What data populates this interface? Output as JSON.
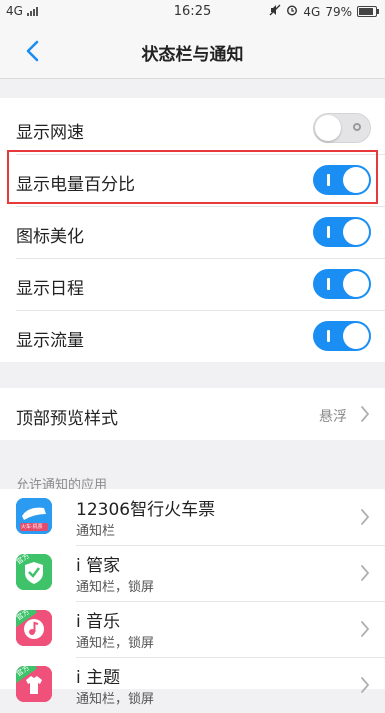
{
  "status_bar": {
    "network": "4G",
    "time": "16:25",
    "network_right": "4G",
    "battery": "79%",
    "icons": [
      "signal-icon",
      "mute-icon",
      "alarm-icon",
      "battery-icon"
    ]
  },
  "nav": {
    "title": "状态栏与通知",
    "back_icon": "back-chevron-icon"
  },
  "toggles": [
    {
      "label": "显示网速",
      "on": false
    },
    {
      "label": "显示电量百分比",
      "on": true
    },
    {
      "label": "图标美化",
      "on": true
    },
    {
      "label": "显示日程",
      "on": true
    },
    {
      "label": "显示流量",
      "on": true
    }
  ],
  "preview": {
    "label": "顶部预览样式",
    "value": "悬浮"
  },
  "apps_section": {
    "header": "允许通知的应用",
    "apps": [
      {
        "name": "12306智行火车票",
        "sub": "通知栏",
        "icon": "train-ticket-icon",
        "icon_text": "火车·机票"
      },
      {
        "name": "i 管家",
        "sub": "通知栏，锁屏",
        "icon": "shield-icon",
        "badge": "官方"
      },
      {
        "name": "i 音乐",
        "sub": "通知栏，锁屏",
        "icon": "music-icon",
        "badge": "官方"
      },
      {
        "name": "i 主题",
        "sub": "通知栏，锁屏",
        "icon": "theme-icon",
        "badge": "官方"
      }
    ]
  },
  "colors": {
    "accent": "#1a8ef2",
    "highlight": "#e5393a",
    "green": "#3ec36a",
    "pink": "#f0517a"
  }
}
